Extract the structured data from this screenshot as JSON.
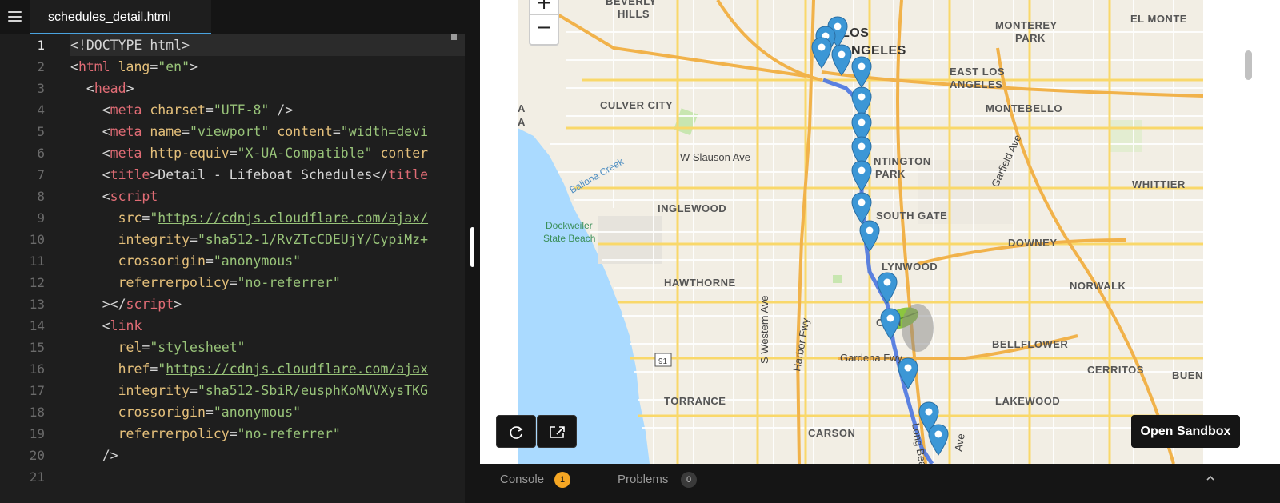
{
  "editor": {
    "tab_label": "schedules_detail.html",
    "line_numbers": [
      "1",
      "2",
      "3",
      "4",
      "5",
      "6",
      "7",
      "8",
      "9",
      "10",
      "11",
      "12",
      "13",
      "14",
      "15",
      "16",
      "17",
      "18",
      "19",
      "20",
      "21"
    ],
    "lines": [
      [
        {
          "c": "p",
          "t": "<!DOCTYPE html>"
        }
      ],
      [
        {
          "c": "p",
          "t": "<"
        },
        {
          "c": "t",
          "t": "html "
        },
        {
          "c": "a",
          "t": "lang"
        },
        {
          "c": "p",
          "t": "="
        },
        {
          "c": "s",
          "t": "\"en\""
        },
        {
          "c": "p",
          "t": ">"
        }
      ],
      [
        {
          "c": "p",
          "t": "  <"
        },
        {
          "c": "t",
          "t": "head"
        },
        {
          "c": "p",
          "t": ">"
        }
      ],
      [
        {
          "c": "p",
          "t": "    <"
        },
        {
          "c": "t",
          "t": "meta "
        },
        {
          "c": "a",
          "t": "charset"
        },
        {
          "c": "p",
          "t": "="
        },
        {
          "c": "s",
          "t": "\"UTF-8\""
        },
        {
          "c": "p",
          "t": " />"
        }
      ],
      [
        {
          "c": "p",
          "t": "    <"
        },
        {
          "c": "t",
          "t": "meta "
        },
        {
          "c": "a",
          "t": "name"
        },
        {
          "c": "p",
          "t": "="
        },
        {
          "c": "s",
          "t": "\"viewport\""
        },
        {
          "c": "p",
          "t": " "
        },
        {
          "c": "a",
          "t": "content"
        },
        {
          "c": "p",
          "t": "="
        },
        {
          "c": "s",
          "t": "\"width=devi"
        }
      ],
      [
        {
          "c": "p",
          "t": "    <"
        },
        {
          "c": "t",
          "t": "meta "
        },
        {
          "c": "a",
          "t": "http-equiv"
        },
        {
          "c": "p",
          "t": "="
        },
        {
          "c": "s",
          "t": "\"X-UA-Compatible\""
        },
        {
          "c": "p",
          "t": " "
        },
        {
          "c": "a",
          "t": "conter"
        }
      ],
      [
        {
          "c": "p",
          "t": "    <"
        },
        {
          "c": "t",
          "t": "title"
        },
        {
          "c": "p",
          "t": ">Detail - Lifeboat Schedules</"
        },
        {
          "c": "t",
          "t": "title"
        }
      ],
      [
        {
          "c": "p",
          "t": "    <"
        },
        {
          "c": "t",
          "t": "script"
        }
      ],
      [
        {
          "c": "p",
          "t": "      "
        },
        {
          "c": "a",
          "t": "src"
        },
        {
          "c": "p",
          "t": "="
        },
        {
          "c": "s",
          "t": "\""
        },
        {
          "c": "su",
          "t": "https://cdnjs.cloudflare.com/ajax/"
        }
      ],
      [
        {
          "c": "p",
          "t": "      "
        },
        {
          "c": "a",
          "t": "integrity"
        },
        {
          "c": "p",
          "t": "="
        },
        {
          "c": "s",
          "t": "\"sha512-1/RvZTcCDEUjY/CypiMz+"
        }
      ],
      [
        {
          "c": "p",
          "t": "      "
        },
        {
          "c": "a",
          "t": "crossorigin"
        },
        {
          "c": "p",
          "t": "="
        },
        {
          "c": "s",
          "t": "\"anonymous\""
        }
      ],
      [
        {
          "c": "p",
          "t": "      "
        },
        {
          "c": "a",
          "t": "referrerpolicy"
        },
        {
          "c": "p",
          "t": "="
        },
        {
          "c": "s",
          "t": "\"no-referrer\""
        }
      ],
      [
        {
          "c": "p",
          "t": "    ></"
        },
        {
          "c": "t",
          "t": "script"
        },
        {
          "c": "p",
          "t": ">"
        }
      ],
      [
        {
          "c": "p",
          "t": "    <"
        },
        {
          "c": "t",
          "t": "link"
        }
      ],
      [
        {
          "c": "p",
          "t": "      "
        },
        {
          "c": "a",
          "t": "rel"
        },
        {
          "c": "p",
          "t": "="
        },
        {
          "c": "s",
          "t": "\"stylesheet\""
        }
      ],
      [
        {
          "c": "p",
          "t": "      "
        },
        {
          "c": "a",
          "t": "href"
        },
        {
          "c": "p",
          "t": "="
        },
        {
          "c": "s",
          "t": "\""
        },
        {
          "c": "su",
          "t": "https://cdnjs.cloudflare.com/ajax"
        }
      ],
      [
        {
          "c": "p",
          "t": "      "
        },
        {
          "c": "a",
          "t": "integrity"
        },
        {
          "c": "p",
          "t": "="
        },
        {
          "c": "s",
          "t": "\"sha512-SbiR/eusphKoMVVXysTKG"
        }
      ],
      [
        {
          "c": "p",
          "t": "      "
        },
        {
          "c": "a",
          "t": "crossorigin"
        },
        {
          "c": "p",
          "t": "="
        },
        {
          "c": "s",
          "t": "\"anonymous\""
        }
      ],
      [
        {
          "c": "p",
          "t": "      "
        },
        {
          "c": "a",
          "t": "referrerpolicy"
        },
        {
          "c": "p",
          "t": "="
        },
        {
          "c": "s",
          "t": "\"no-referrer\""
        }
      ],
      [
        {
          "c": "p",
          "t": "    />"
        }
      ],
      [
        {
          "c": "p",
          "t": ""
        }
      ]
    ]
  },
  "preview": {
    "zoom_in": "+",
    "zoom_out": "−",
    "open_sandbox": "Open Sandbox"
  },
  "map_labels": {
    "beverly_hills_1": "BEVERLY",
    "beverly_hills_2": "HILLS",
    "los_angeles_1": "LOS",
    "los_angeles_2": "ANGELES",
    "monterey_park_1": "MONTEREY",
    "monterey_park_2": "PARK",
    "el_monte": "EL MONTE",
    "east_la_1": "EAST LOS",
    "east_la_2": "ANGELES",
    "culver_city": "CULVER CITY",
    "montebello": "MONTEBELLO",
    "slauson": "W Slauson Ave",
    "huntington_1": "NTINGTON",
    "huntington_2": "PARK",
    "whittier": "WHITTIER",
    "ballona": "Ballona Creek",
    "garfield": "Garfield Ave",
    "inglewood": "INGLEWOOD",
    "south_gate": "SOUTH GATE",
    "dockweiler_1": "Dockweiler",
    "dockweiler_2": "State Beach",
    "downey": "DOWNEY",
    "lynwood": "LYNWOOD",
    "hawthorne": "HAWTHORNE",
    "norwalk": "NORWALK",
    "compton": "COM",
    "bellflower": "BELLFLOWER",
    "western": "S Western Ave",
    "harbor": "Harbor Fwy",
    "gardena": "Gardena Fwy",
    "route91": "91",
    "cerritos": "CERRITOS",
    "buena": "BUEN",
    "lakewood": "LAKEWOOD",
    "torrance": "TORRANCE",
    "carson": "CARSON",
    "long_beach": "Long Bea",
    "ave": "Ave",
    "la_edge_1": "A",
    "la_edge_2": "A"
  },
  "bottom": {
    "console_label": "Console",
    "console_count": "1",
    "problems_label": "Problems",
    "problems_count": "0"
  },
  "colors": {
    "route": "#4a74e0",
    "marker": "#3c97d6",
    "accent_tab": "#4aa3df"
  },
  "icons": [
    "menu-icon",
    "refresh-icon",
    "open-external-icon",
    "chevron-up-icon",
    "map-marker-icon",
    "leaf-icon"
  ]
}
